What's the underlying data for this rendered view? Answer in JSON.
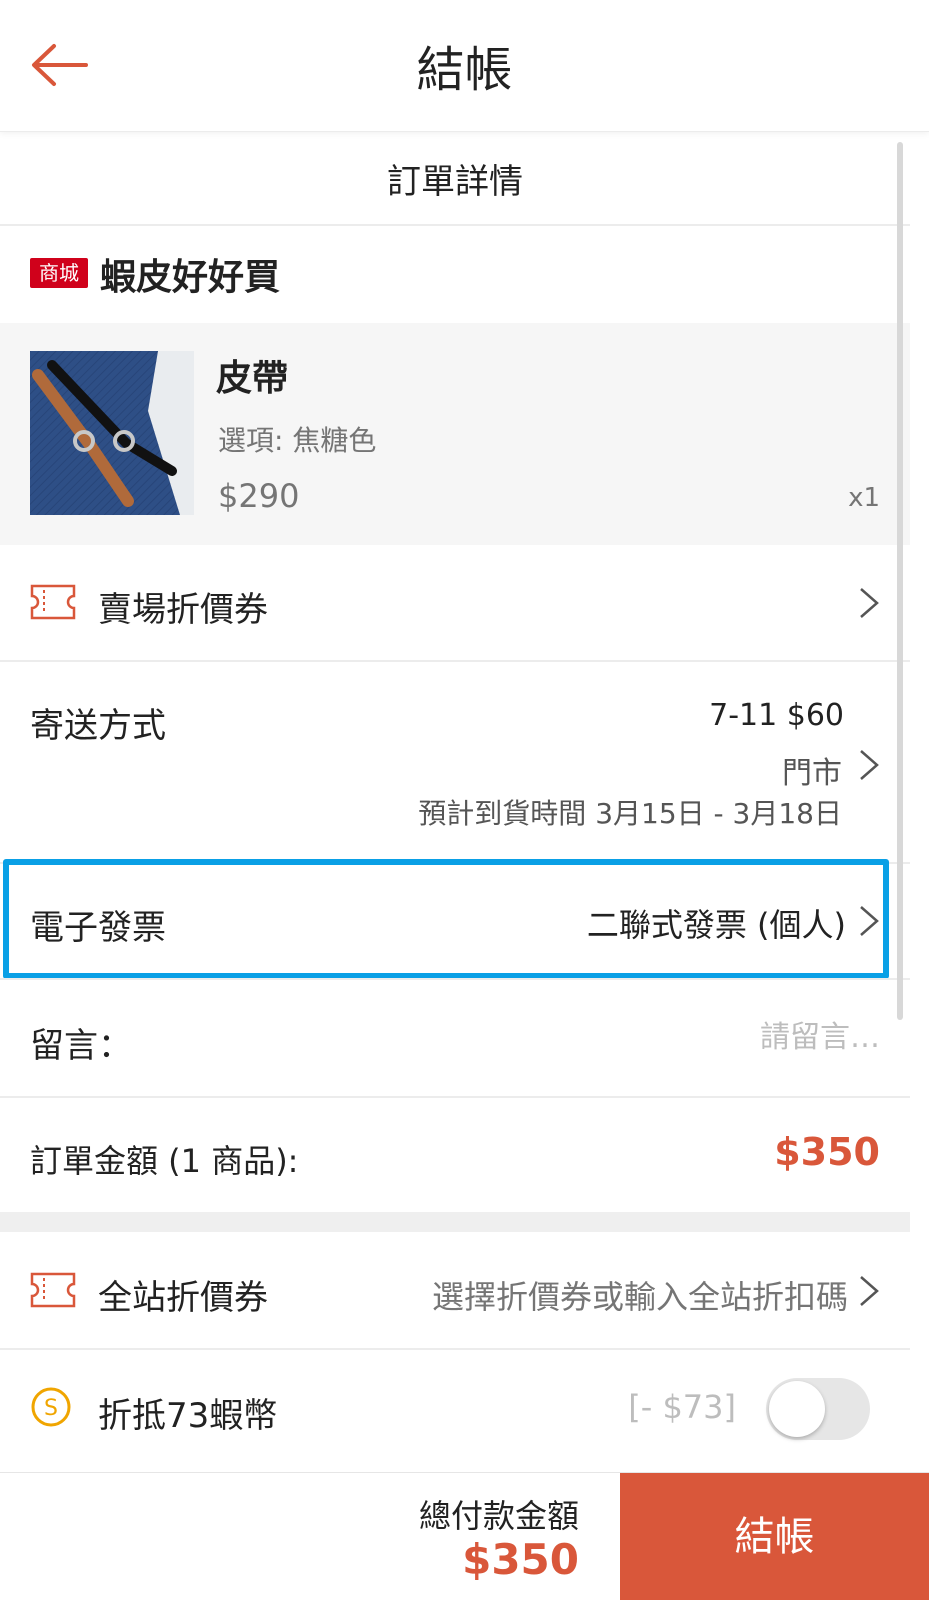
{
  "header": {
    "title": "結帳"
  },
  "order": {
    "section_title": "訂單詳情"
  },
  "shop": {
    "badge": "商城",
    "name": "蝦皮好好買"
  },
  "product": {
    "name": "皮帶",
    "option": "選項: 焦糖色",
    "price": "$290",
    "qty": "x1"
  },
  "shop_voucher": {
    "label": "賣場折價券"
  },
  "shipping": {
    "label": "寄送方式",
    "price": "7-11 $60",
    "store": "門市",
    "eta": "預計到貨時間 3月15日 - 3月18日"
  },
  "invoice": {
    "label": "電子發票",
    "value": "二聯式發票 (個人)"
  },
  "message": {
    "label": "留言：",
    "placeholder": "請留言…",
    "value": ""
  },
  "order_total": {
    "label": "訂單金額 (1 商品):",
    "value": "$350"
  },
  "site_voucher": {
    "label": "全站折價券",
    "value": "選擇折價券或輸入全站折扣碼"
  },
  "coins": {
    "label": "折抵73蝦幣",
    "amount": "[- $73]",
    "enabled": false
  },
  "footer": {
    "pay_label": "總付款金額",
    "pay_value": "$350",
    "checkout_label": "結帳"
  },
  "colors": {
    "accent": "#d9573a",
    "mall_badge": "#d0011b",
    "highlight": "#0aa0e6"
  }
}
